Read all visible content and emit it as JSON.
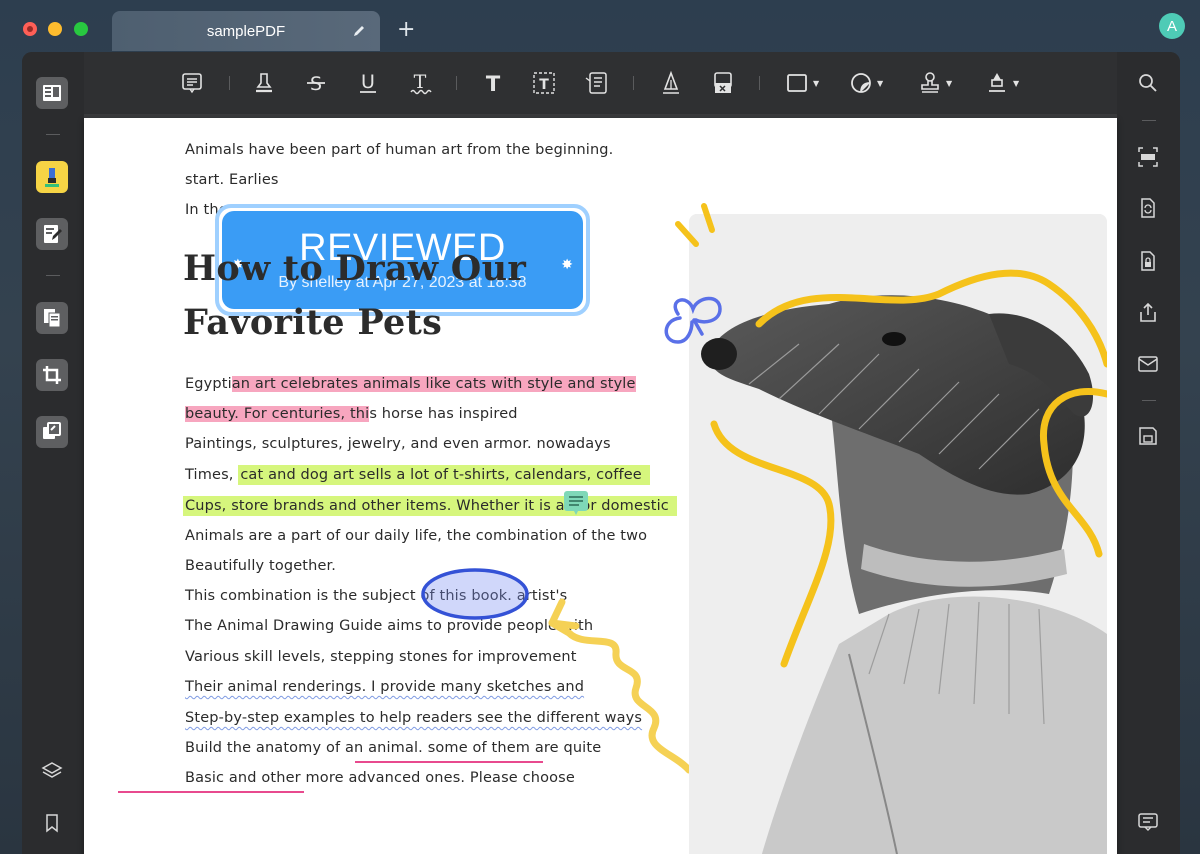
{
  "window": {
    "tab_title": "samplePDF",
    "new_tab_symbol": "+",
    "avatar_initial": "A"
  },
  "toolbar": {
    "text_tools": [
      "T"
    ]
  },
  "stamp": {
    "title": "REVIEWED",
    "subtitle": "By shelley at Apr 27, 2023 at 18:38",
    "color": "#3a9cf5"
  },
  "document": {
    "intro_lines": [
      "Animals have been part of human art from the beginning.",
      "start. Earlies",
      "In the cave, a"
    ],
    "heading_lines": [
      "How to Draw Our",
      "Favorite Pets"
    ],
    "body": {
      "l1_plain": "Egypti",
      "l1_pink": "an art celebrates animals like cats with style and style",
      "l2_pink": "beauty. For centuries, thi",
      "l2_plain": "s horse has inspired",
      "l3": "Paintings, sculptures, jewelry, and even armor. nowadays",
      "l4_plain": "Times, ",
      "l4_green": "cat and dog art sells a lot of t-shirts, calendars, coffee",
      "l5_green": "Cups, store brands and other items. Whether it is art or domestic",
      "l6": "Animals are a part of our daily life, the combination of the two",
      "l7": "Beautifully together.",
      "l8": "This combination is the subject of this book. artist's",
      "l9": "The Animal Drawing Guide aims to provide people with",
      "l10": "Various skill levels, stepping stones for improvement",
      "l11": "Their animal renderings. I provide many sketches and",
      "l12": "Step-by-step examples to help readers see the different ways",
      "l13_plain": "Build the anatomy of an animal. ",
      "l13_under": "some of them are quite",
      "l14_under": "Basic and other more adv",
      "l14_plain": "anced ones. Please choose"
    }
  },
  "colors": {
    "highlight_pink": "#f7a6bf",
    "highlight_green": "#d6f67d",
    "underline_pink": "#e84a8e",
    "squiggle_blue": "#7f9be3",
    "doodle_yellow": "#f5c21b",
    "ellipse_blue": "#3452d6",
    "accent_active": "#f6c744"
  }
}
